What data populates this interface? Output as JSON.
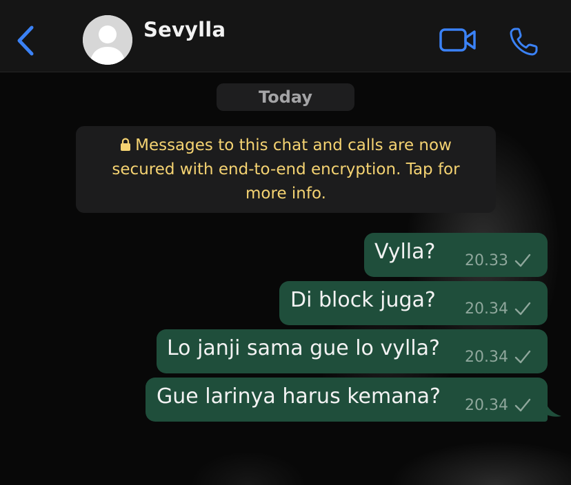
{
  "header": {
    "contact_name": "Sevylla"
  },
  "chat": {
    "date_label": "Today",
    "encryption_notice": "Messages to this chat and calls are now secured with end-to-end encryption. Tap for more info.",
    "messages": [
      {
        "text": "Vylla?",
        "time": "20.33",
        "direction": "outgoing",
        "status": "sent"
      },
      {
        "text": "Di block juga?",
        "time": "20.34",
        "direction": "outgoing",
        "status": "sent"
      },
      {
        "text": "Lo janji sama gue lo vylla?",
        "time": "20.34",
        "direction": "outgoing",
        "status": "sent"
      },
      {
        "text": "Gue larinya harus kemana?",
        "time": "20.34",
        "direction": "outgoing",
        "status": "sent"
      }
    ]
  },
  "colors": {
    "accent_blue": "#3b82f6",
    "outgoing_bubble": "#1f4e3b",
    "notice_text": "#f5d372",
    "header_bg": "#151515"
  },
  "icons": {
    "back": "chevron-left-icon",
    "video": "video-camera-icon",
    "call": "phone-icon",
    "lock": "lock-icon",
    "check": "check-icon"
  }
}
